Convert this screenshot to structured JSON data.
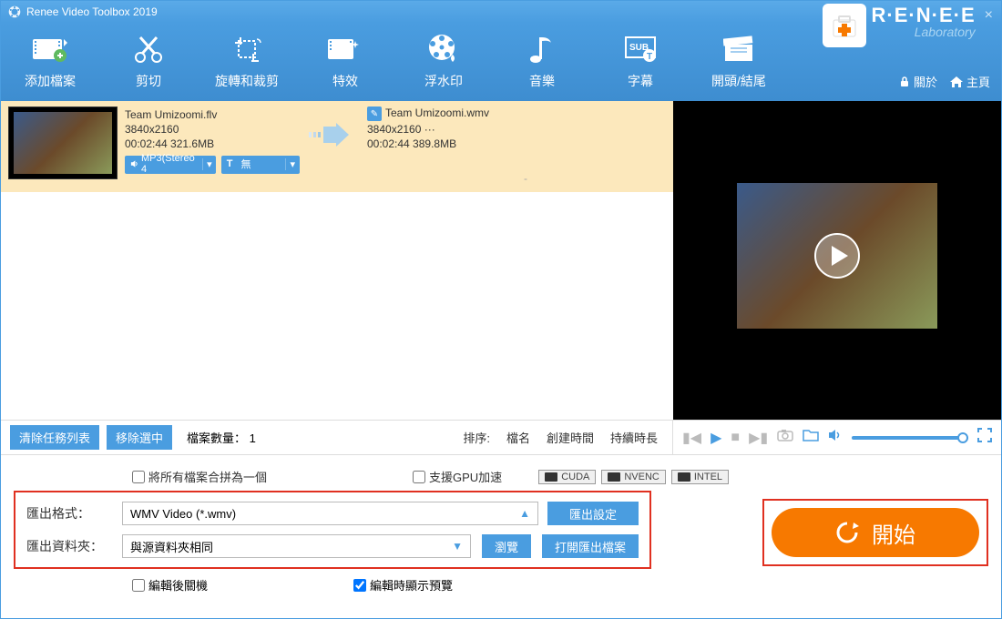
{
  "titlebar": {
    "title": "Renee Video Toolbox 2019"
  },
  "brand": {
    "main": "R·E·N·E·E",
    "sub": "Laboratory"
  },
  "header_links": {
    "about": "關於",
    "home": "主頁"
  },
  "toolbar": [
    {
      "label": "添加檔案",
      "name": "add-file"
    },
    {
      "label": "剪切",
      "name": "cut"
    },
    {
      "label": "旋轉和裁剪",
      "name": "rotate-crop"
    },
    {
      "label": "特效",
      "name": "effects"
    },
    {
      "label": "浮水印",
      "name": "watermark"
    },
    {
      "label": "音樂",
      "name": "music"
    },
    {
      "label": "字幕",
      "name": "subtitle"
    },
    {
      "label": "開頭/結尾",
      "name": "intro-outro"
    }
  ],
  "file": {
    "src_name": "Team Umizoomi.flv",
    "src_res": "3840x2160",
    "src_dur_size": "00:02:44  321.6MB",
    "out_name": "Team Umizoomi.wmv",
    "out_res": "3840x2160    ···",
    "out_dur_size": "00:02:44  389.8MB",
    "audio_chip": "MP3(Stereo 4",
    "subtitle_chip": "無",
    "dash": "-"
  },
  "listbar": {
    "clear": "清除任務列表",
    "remove": "移除選中",
    "count_label": "檔案數量：",
    "count_value": "1",
    "sort_label": "排序:",
    "sort_name": "檔名",
    "sort_created": "創建時間",
    "sort_duration": "持續時長"
  },
  "bottom": {
    "merge": "將所有檔案合拼為一個",
    "gpu": "支援GPU加速",
    "gpu_cuda": "CUDA",
    "gpu_nvenc": "NVENC",
    "gpu_intel": "INTEL",
    "format_label": "匯出格式：",
    "format_value": "WMV Video (*.wmv)",
    "export_settings": "匯出設定",
    "folder_label": "匯出資料夾：",
    "folder_value": "與源資料夾相同",
    "browse": "瀏覽",
    "open_folder": "打開匯出檔案",
    "shutdown": "編輯後關機",
    "preview_edit": "編輯時顯示預覽",
    "start": "開始"
  }
}
